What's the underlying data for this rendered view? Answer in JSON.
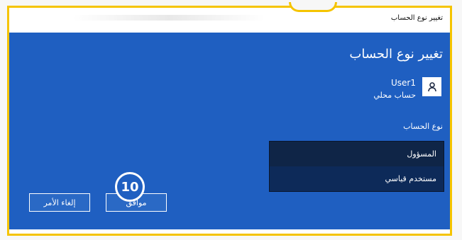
{
  "window": {
    "title": "تغيير نوع الحساب"
  },
  "dialog": {
    "heading": "تغيير نوع الحساب",
    "user": {
      "name": "User1",
      "kind": "حساب محلي",
      "avatar_icon": "user-avatar-icon"
    },
    "account_type_label": "نوع الحساب",
    "account_types": [
      {
        "label": "المسؤول",
        "selected": true
      },
      {
        "label": "مستخدم قياسي",
        "selected": false
      }
    ],
    "buttons": {
      "ok": "موافق",
      "cancel": "إلغاء الأمر"
    }
  },
  "annotation": {
    "step_number": "10",
    "colors": {
      "frame": "#f5c400",
      "badge_fill": "#1f5fc1",
      "badge_border": "#ffffff"
    }
  },
  "colors": {
    "background": "#1f5fc1",
    "options_background": "#0b1f3f",
    "text": "#ffffff"
  }
}
